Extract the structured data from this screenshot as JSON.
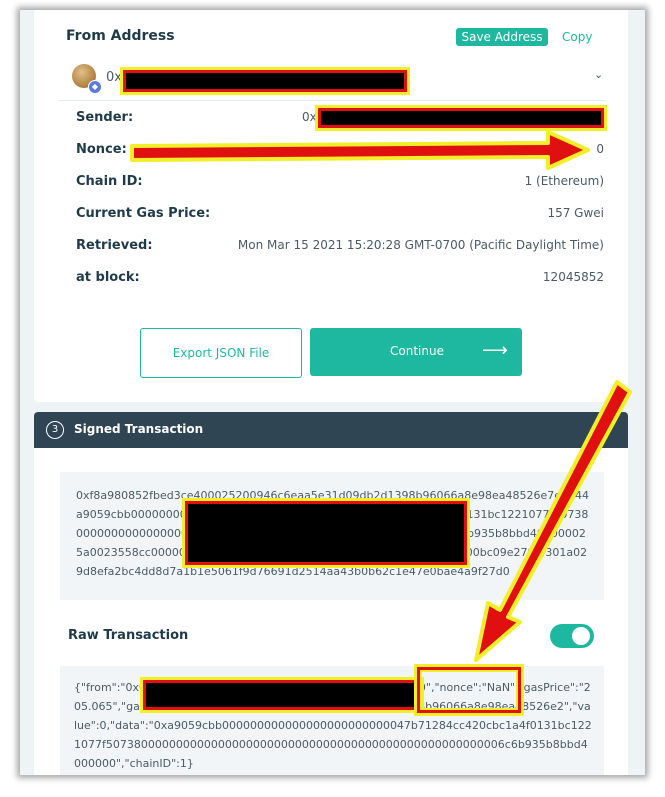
{
  "from_address": {
    "title": "From Address",
    "save_label": "Save Address",
    "copy_label": "Copy",
    "selected_prefix": "0x"
  },
  "details": {
    "sender_label": "Sender:",
    "sender_prefix": "0x",
    "nonce_label": "Nonce:",
    "nonce_value": "0",
    "chain_label": "Chain ID:",
    "chain_value": "1 (Ethereum)",
    "gas_label": "Current Gas Price:",
    "gas_value": "157 Gwei",
    "retrieved_label": "Retrieved:",
    "retrieved_value": "Mon Mar 15 2021 15:20:28 GMT-0700 (Pacific Daylight Time)",
    "block_label": "at block:",
    "block_value": "12045852"
  },
  "actions": {
    "export_label": "Export JSON File",
    "continue_label": "Continue",
    "continue_arrow": "⟶"
  },
  "signed": {
    "step_number": "3",
    "title": "Signed Transaction",
    "text": "0xf8a980852fbed3ce400025200946c6eaa5e31d09db2d1398b96066a8e98ea48526e7e5844a9059cbb000000000000000000000000000047b71284cc420cbc1a4f0131bc1221077f50738000000000000000000000000000000000000000000000000000006c6b935b8bbd400000025a0023558cc00000000000000000000000000000000000000000000000bc09e2797f301a029d8efa2bc4dd8d7a1b1e5061f9d76691d2514aa43b0b62c1e47e0bae4a9f27d0"
  },
  "raw": {
    "title": "Raw Transaction",
    "text": "{\"from\":\"0x00000000000000000000000000000000000000000\",\"nonce\":\"NaN\",\"gasPrice\":\"205.065\",\"gasLimit\":\"0x5208\",\"to\":\"0x6c6eaa5e31d09db2d1398b96066a8e98ea48526e2\",\"value\":0,\"data\":\"0xa9059cbb000000000000000000000000047b71284cc420cbc1a4f0131bc1221077f507380000000000000000000000000000000000000000000000000006c6b935b8bbd4000000\",\"chainID\":1}"
  },
  "icons": {
    "chevron": "chevron-down-icon",
    "badge": "ethereum-badge-icon"
  },
  "colors": {
    "accent": "#1eb8a1",
    "header_bar": "#2f4554",
    "annotation_red": "#e01010",
    "annotation_yellow": "#f2ee28"
  }
}
